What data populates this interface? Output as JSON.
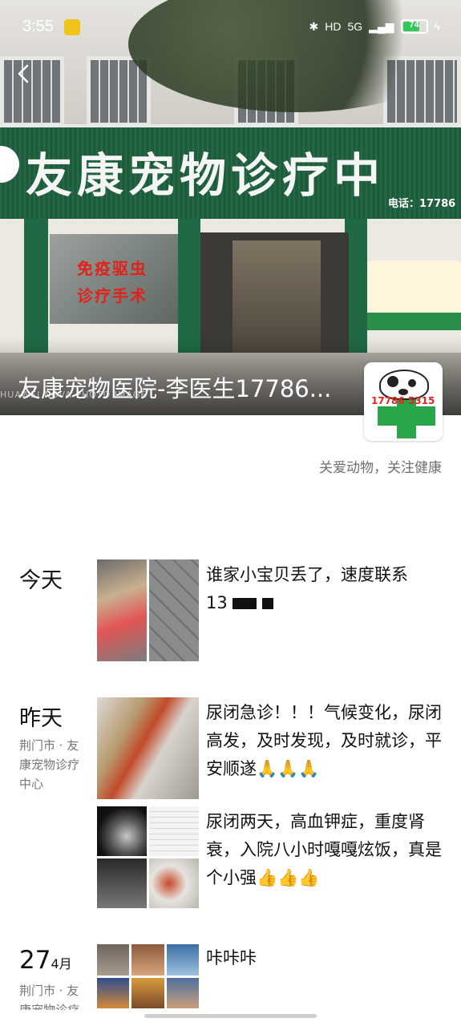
{
  "status_bar": {
    "time": "3:55",
    "network": "5G",
    "battery": "74",
    "accent": "#34c759"
  },
  "cover": {
    "sign_text": "友康宠物诊疗中",
    "sign_phone": "电话：17786",
    "window_text_1": "免疫驱虫",
    "window_text_2": "诊疗手术",
    "watermark": "HUAWEI  NOVA  PHOTO  IMAGE"
  },
  "profile": {
    "title": "友康宠物医院-李医生17786...",
    "avatar_phone": "17786 5315",
    "signature": "关爱动物，关注健康"
  },
  "feed": {
    "today": {
      "date": "今天",
      "text_line1": "谁家小宝贝丢了，速度联系",
      "text_prefix": "13"
    },
    "yesterday": {
      "date": "昨天",
      "location": "荆门市 · 友康宠物诊疗中心",
      "post1": "尿闭急诊！！！气候变化，尿闭高发，及时发现，及时就诊，平安顺遂🙏🙏🙏",
      "post2": "尿闭两天，高血钾症，重度肾衰，入院八小时嘎嘎炫饭，真是个小强👍👍👍"
    },
    "apr27": {
      "day": "27",
      "month": "4月",
      "location": "荆门市 · 友康宠物诊疗中心",
      "text": "咔咔咔"
    }
  }
}
